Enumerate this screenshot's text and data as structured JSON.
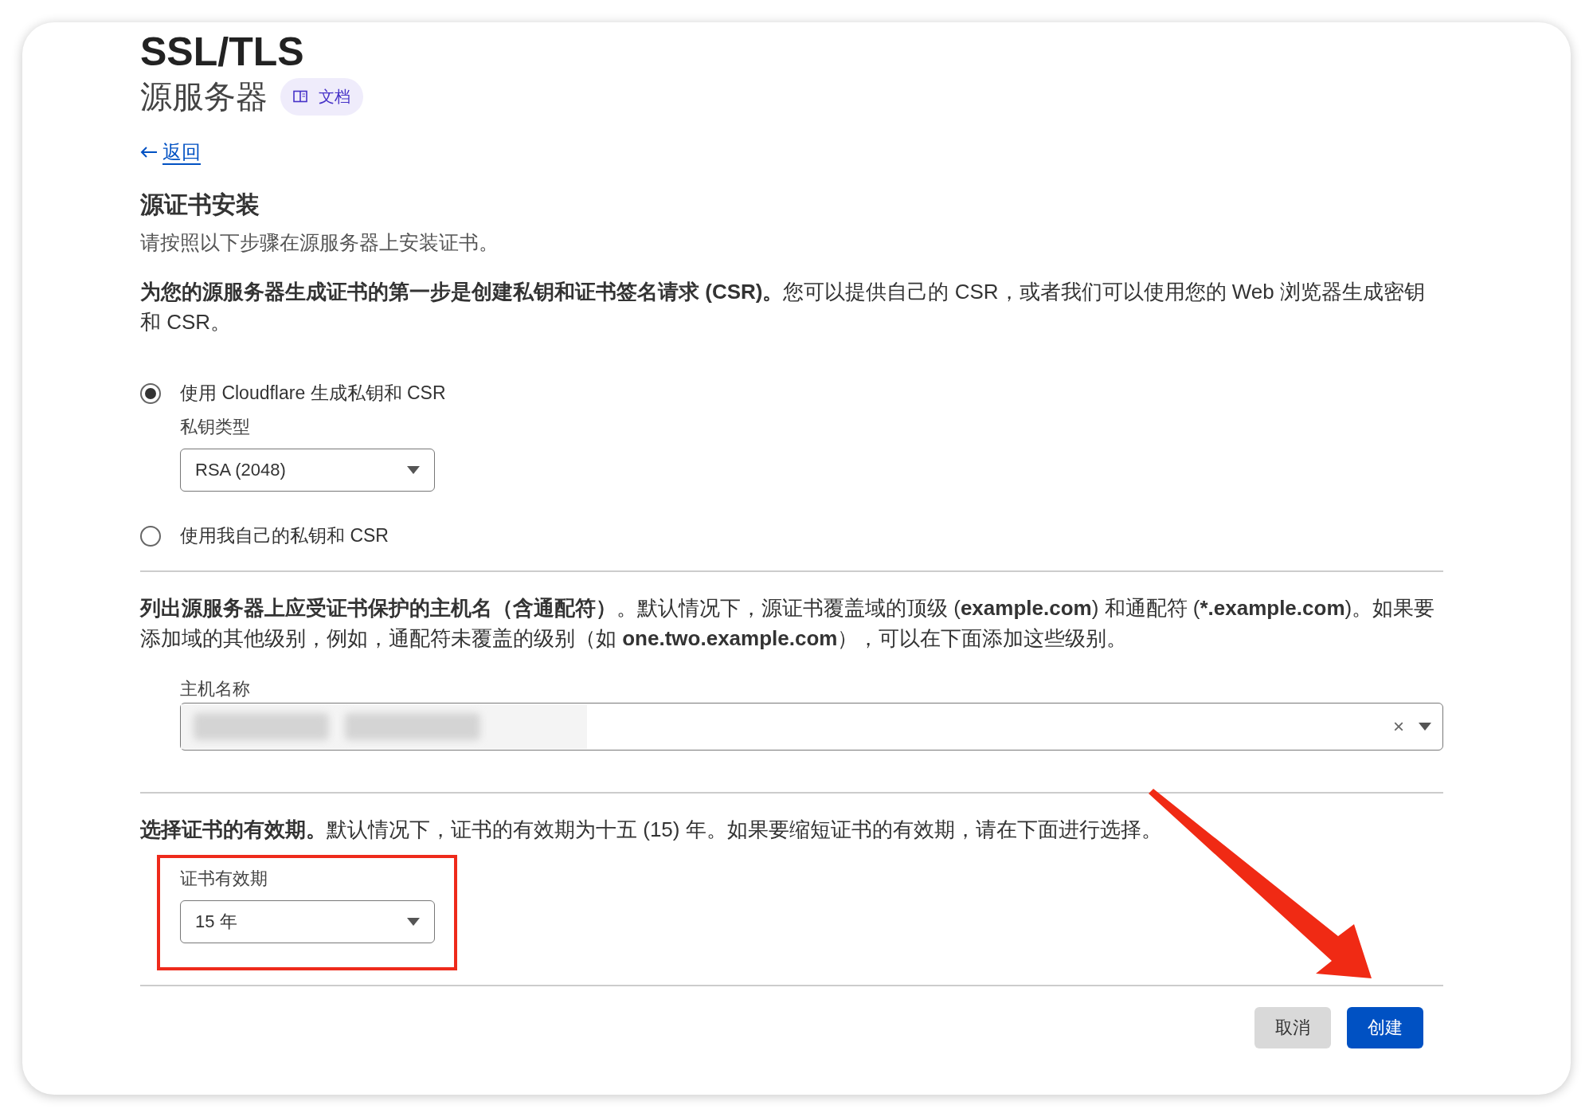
{
  "header": {
    "title": "SSL/TLS",
    "subtitle": "源服务器",
    "docs_badge": "文档"
  },
  "back_link": "返回",
  "section": {
    "title": "源证书安装",
    "description": "请按照以下步骤在源服务器上安装证书。"
  },
  "csr_intro": [
    {
      "text": "为您的源服务器生成证书的第一步是创建私钥和证书签名请求 (CSR)。",
      "bold": true
    },
    {
      "text": "您可以提供自己的 CSR，或者我们可以使用您的 Web 浏览器生成密钥和 CSR。",
      "bold": false
    }
  ],
  "key_options": [
    {
      "label": "使用 Cloudflare 生成私钥和 CSR",
      "selected": true,
      "field": {
        "label": "私钥类型",
        "value": "RSA (2048)"
      }
    },
    {
      "label": "使用我自己的私钥和 CSR",
      "selected": false
    }
  ],
  "hostnames_intro": [
    {
      "text": "列出源服务器上应受证书保护的主机名（含通配符）",
      "bold": true
    },
    {
      "text": "。默认情况下，源证书覆盖域的顶级 (",
      "bold": false
    },
    {
      "text": "example.com",
      "bold": true
    },
    {
      "text": ") 和通配符 (",
      "bold": false
    },
    {
      "text": "*.example.com",
      "bold": true
    },
    {
      "text": ")。如果要添加域的其他级别，例如，通配符未覆盖的级别（如 ",
      "bold": false
    },
    {
      "text": "one.two.example.com",
      "bold": true
    },
    {
      "text": "），可以在下面添加这些级别。",
      "bold": false
    }
  ],
  "hostnames_field": {
    "label": "主机名称",
    "clear_icon": "×"
  },
  "validity_intro": [
    {
      "text": "选择证书的有效期。",
      "bold": true
    },
    {
      "text": "默认情况下，证书的有效期为十五 (15) 年。如果要缩短证书的有效期，请在下面进行选择。",
      "bold": false
    }
  ],
  "validity_field": {
    "label": "证书有效期",
    "value": "15 年"
  },
  "buttons": [
    {
      "label": "取消",
      "kind": "secondary"
    },
    {
      "label": "创建",
      "kind": "primary"
    }
  ]
}
